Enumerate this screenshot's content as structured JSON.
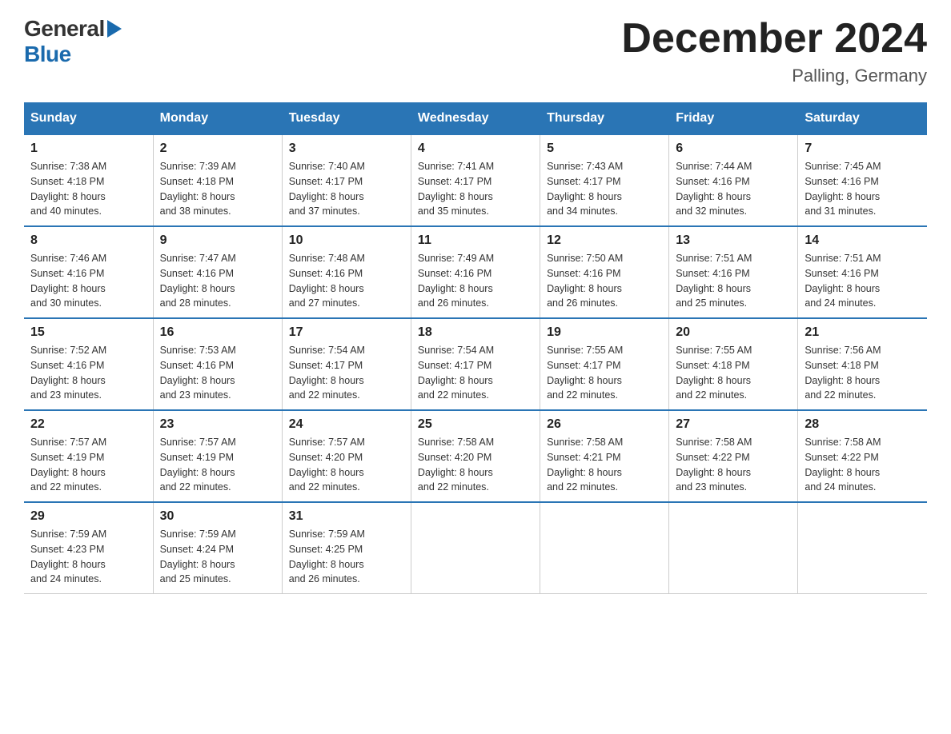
{
  "header": {
    "logo_general": "General",
    "logo_blue": "Blue",
    "title": "December 2024",
    "subtitle": "Palling, Germany"
  },
  "days_of_week": [
    "Sunday",
    "Monday",
    "Tuesday",
    "Wednesday",
    "Thursday",
    "Friday",
    "Saturday"
  ],
  "weeks": [
    [
      {
        "day": "1",
        "sunrise": "7:38 AM",
        "sunset": "4:18 PM",
        "daylight": "8 hours and 40 minutes."
      },
      {
        "day": "2",
        "sunrise": "7:39 AM",
        "sunset": "4:18 PM",
        "daylight": "8 hours and 38 minutes."
      },
      {
        "day": "3",
        "sunrise": "7:40 AM",
        "sunset": "4:17 PM",
        "daylight": "8 hours and 37 minutes."
      },
      {
        "day": "4",
        "sunrise": "7:41 AM",
        "sunset": "4:17 PM",
        "daylight": "8 hours and 35 minutes."
      },
      {
        "day": "5",
        "sunrise": "7:43 AM",
        "sunset": "4:17 PM",
        "daylight": "8 hours and 34 minutes."
      },
      {
        "day": "6",
        "sunrise": "7:44 AM",
        "sunset": "4:16 PM",
        "daylight": "8 hours and 32 minutes."
      },
      {
        "day": "7",
        "sunrise": "7:45 AM",
        "sunset": "4:16 PM",
        "daylight": "8 hours and 31 minutes."
      }
    ],
    [
      {
        "day": "8",
        "sunrise": "7:46 AM",
        "sunset": "4:16 PM",
        "daylight": "8 hours and 30 minutes."
      },
      {
        "day": "9",
        "sunrise": "7:47 AM",
        "sunset": "4:16 PM",
        "daylight": "8 hours and 28 minutes."
      },
      {
        "day": "10",
        "sunrise": "7:48 AM",
        "sunset": "4:16 PM",
        "daylight": "8 hours and 27 minutes."
      },
      {
        "day": "11",
        "sunrise": "7:49 AM",
        "sunset": "4:16 PM",
        "daylight": "8 hours and 26 minutes."
      },
      {
        "day": "12",
        "sunrise": "7:50 AM",
        "sunset": "4:16 PM",
        "daylight": "8 hours and 26 minutes."
      },
      {
        "day": "13",
        "sunrise": "7:51 AM",
        "sunset": "4:16 PM",
        "daylight": "8 hours and 25 minutes."
      },
      {
        "day": "14",
        "sunrise": "7:51 AM",
        "sunset": "4:16 PM",
        "daylight": "8 hours and 24 minutes."
      }
    ],
    [
      {
        "day": "15",
        "sunrise": "7:52 AM",
        "sunset": "4:16 PM",
        "daylight": "8 hours and 23 minutes."
      },
      {
        "day": "16",
        "sunrise": "7:53 AM",
        "sunset": "4:16 PM",
        "daylight": "8 hours and 23 minutes."
      },
      {
        "day": "17",
        "sunrise": "7:54 AM",
        "sunset": "4:17 PM",
        "daylight": "8 hours and 22 minutes."
      },
      {
        "day": "18",
        "sunrise": "7:54 AM",
        "sunset": "4:17 PM",
        "daylight": "8 hours and 22 minutes."
      },
      {
        "day": "19",
        "sunrise": "7:55 AM",
        "sunset": "4:17 PM",
        "daylight": "8 hours and 22 minutes."
      },
      {
        "day": "20",
        "sunrise": "7:55 AM",
        "sunset": "4:18 PM",
        "daylight": "8 hours and 22 minutes."
      },
      {
        "day": "21",
        "sunrise": "7:56 AM",
        "sunset": "4:18 PM",
        "daylight": "8 hours and 22 minutes."
      }
    ],
    [
      {
        "day": "22",
        "sunrise": "7:57 AM",
        "sunset": "4:19 PM",
        "daylight": "8 hours and 22 minutes."
      },
      {
        "day": "23",
        "sunrise": "7:57 AM",
        "sunset": "4:19 PM",
        "daylight": "8 hours and 22 minutes."
      },
      {
        "day": "24",
        "sunrise": "7:57 AM",
        "sunset": "4:20 PM",
        "daylight": "8 hours and 22 minutes."
      },
      {
        "day": "25",
        "sunrise": "7:58 AM",
        "sunset": "4:20 PM",
        "daylight": "8 hours and 22 minutes."
      },
      {
        "day": "26",
        "sunrise": "7:58 AM",
        "sunset": "4:21 PM",
        "daylight": "8 hours and 22 minutes."
      },
      {
        "day": "27",
        "sunrise": "7:58 AM",
        "sunset": "4:22 PM",
        "daylight": "8 hours and 23 minutes."
      },
      {
        "day": "28",
        "sunrise": "7:58 AM",
        "sunset": "4:22 PM",
        "daylight": "8 hours and 24 minutes."
      }
    ],
    [
      {
        "day": "29",
        "sunrise": "7:59 AM",
        "sunset": "4:23 PM",
        "daylight": "8 hours and 24 minutes."
      },
      {
        "day": "30",
        "sunrise": "7:59 AM",
        "sunset": "4:24 PM",
        "daylight": "8 hours and 25 minutes."
      },
      {
        "day": "31",
        "sunrise": "7:59 AM",
        "sunset": "4:25 PM",
        "daylight": "8 hours and 26 minutes."
      },
      null,
      null,
      null,
      null
    ]
  ],
  "labels": {
    "sunrise": "Sunrise:",
    "sunset": "Sunset:",
    "daylight": "Daylight:"
  }
}
